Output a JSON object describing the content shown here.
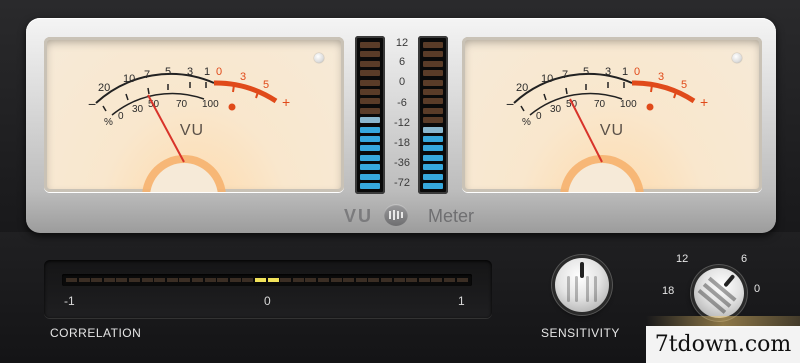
{
  "vu_meters": {
    "left": {
      "scale_top": [
        "20",
        "10",
        "7",
        "5",
        "3",
        "1",
        "0",
        "3",
        "5"
      ],
      "scale_bottom": [
        "0",
        "30",
        "50",
        "70",
        "100"
      ],
      "minus": "−",
      "plus": "+",
      "percent": "%",
      "label": "VU",
      "needle_value_db": -9
    },
    "right": {
      "scale_top": [
        "20",
        "10",
        "7",
        "5",
        "3",
        "1",
        "0",
        "3",
        "5"
      ],
      "scale_bottom": [
        "0",
        "30",
        "50",
        "70",
        "100"
      ],
      "minus": "−",
      "plus": "+",
      "percent": "%",
      "label": "VU",
      "needle_value_db": -4
    }
  },
  "peak_meter": {
    "scale": [
      "12",
      "6",
      "0",
      "-6",
      "-12",
      "-18",
      "-36",
      "-72"
    ],
    "left_lit_segments": 8,
    "right_lit_segments": 7,
    "colors": {
      "lit": "#36a8dc",
      "dim": "#5a3c28",
      "pale": "#8ab8cf"
    }
  },
  "brand": {
    "vu": "VU",
    "meter": "Meter",
    "logo_icon": "presonus-logo-icon"
  },
  "correlation": {
    "label": "CORRELATION",
    "scale": [
      "-1",
      "0",
      "1"
    ],
    "active_color": "#f1e25a"
  },
  "sensitivity": {
    "label": "SENSITIVITY"
  },
  "range_knob": {
    "labels": [
      "12",
      "6",
      "18",
      "0"
    ]
  },
  "watermark": {
    "text": "7tdown.com"
  },
  "colors": {
    "meter_face": "#f6ead8",
    "red_scale": "#e04a1a",
    "needle": "#d8332a",
    "scale_text": "#2a2a2a"
  }
}
